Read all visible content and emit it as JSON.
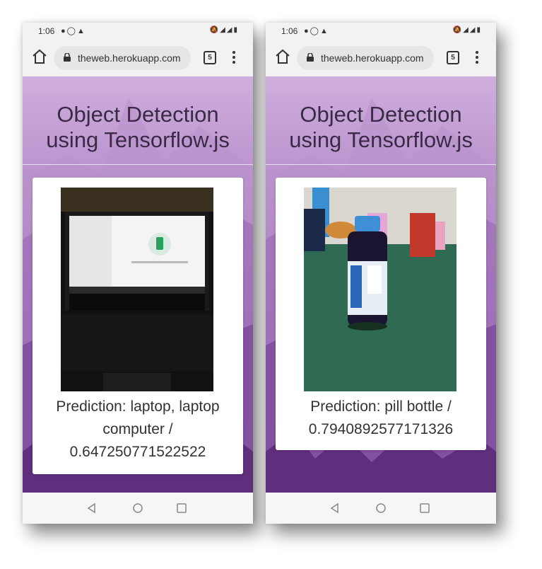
{
  "status_bar": {
    "time": "1:06",
    "left_icons": [
      "chat-bubble-icon",
      "whatsapp-icon",
      "drive-icon"
    ],
    "right_icons": [
      "mute-icon",
      "wifi-icon",
      "signal-icon",
      "battery-icon"
    ]
  },
  "browser": {
    "url": "theweb.herokuapp.com",
    "tab_count": "5"
  },
  "page": {
    "title": "Object Detection using Tensorflow.js"
  },
  "screens": [
    {
      "image_subject": "laptop",
      "prediction": "Prediction: laptop, laptop computer / 0.647250771522522"
    },
    {
      "image_subject": "pill bottle",
      "prediction": "Prediction: pill bottle / 0.7940892577171326"
    }
  ],
  "nav": {
    "back_icon": "triangle-back-icon",
    "home_icon": "circle-home-icon",
    "recent_icon": "square-recent-icon"
  }
}
